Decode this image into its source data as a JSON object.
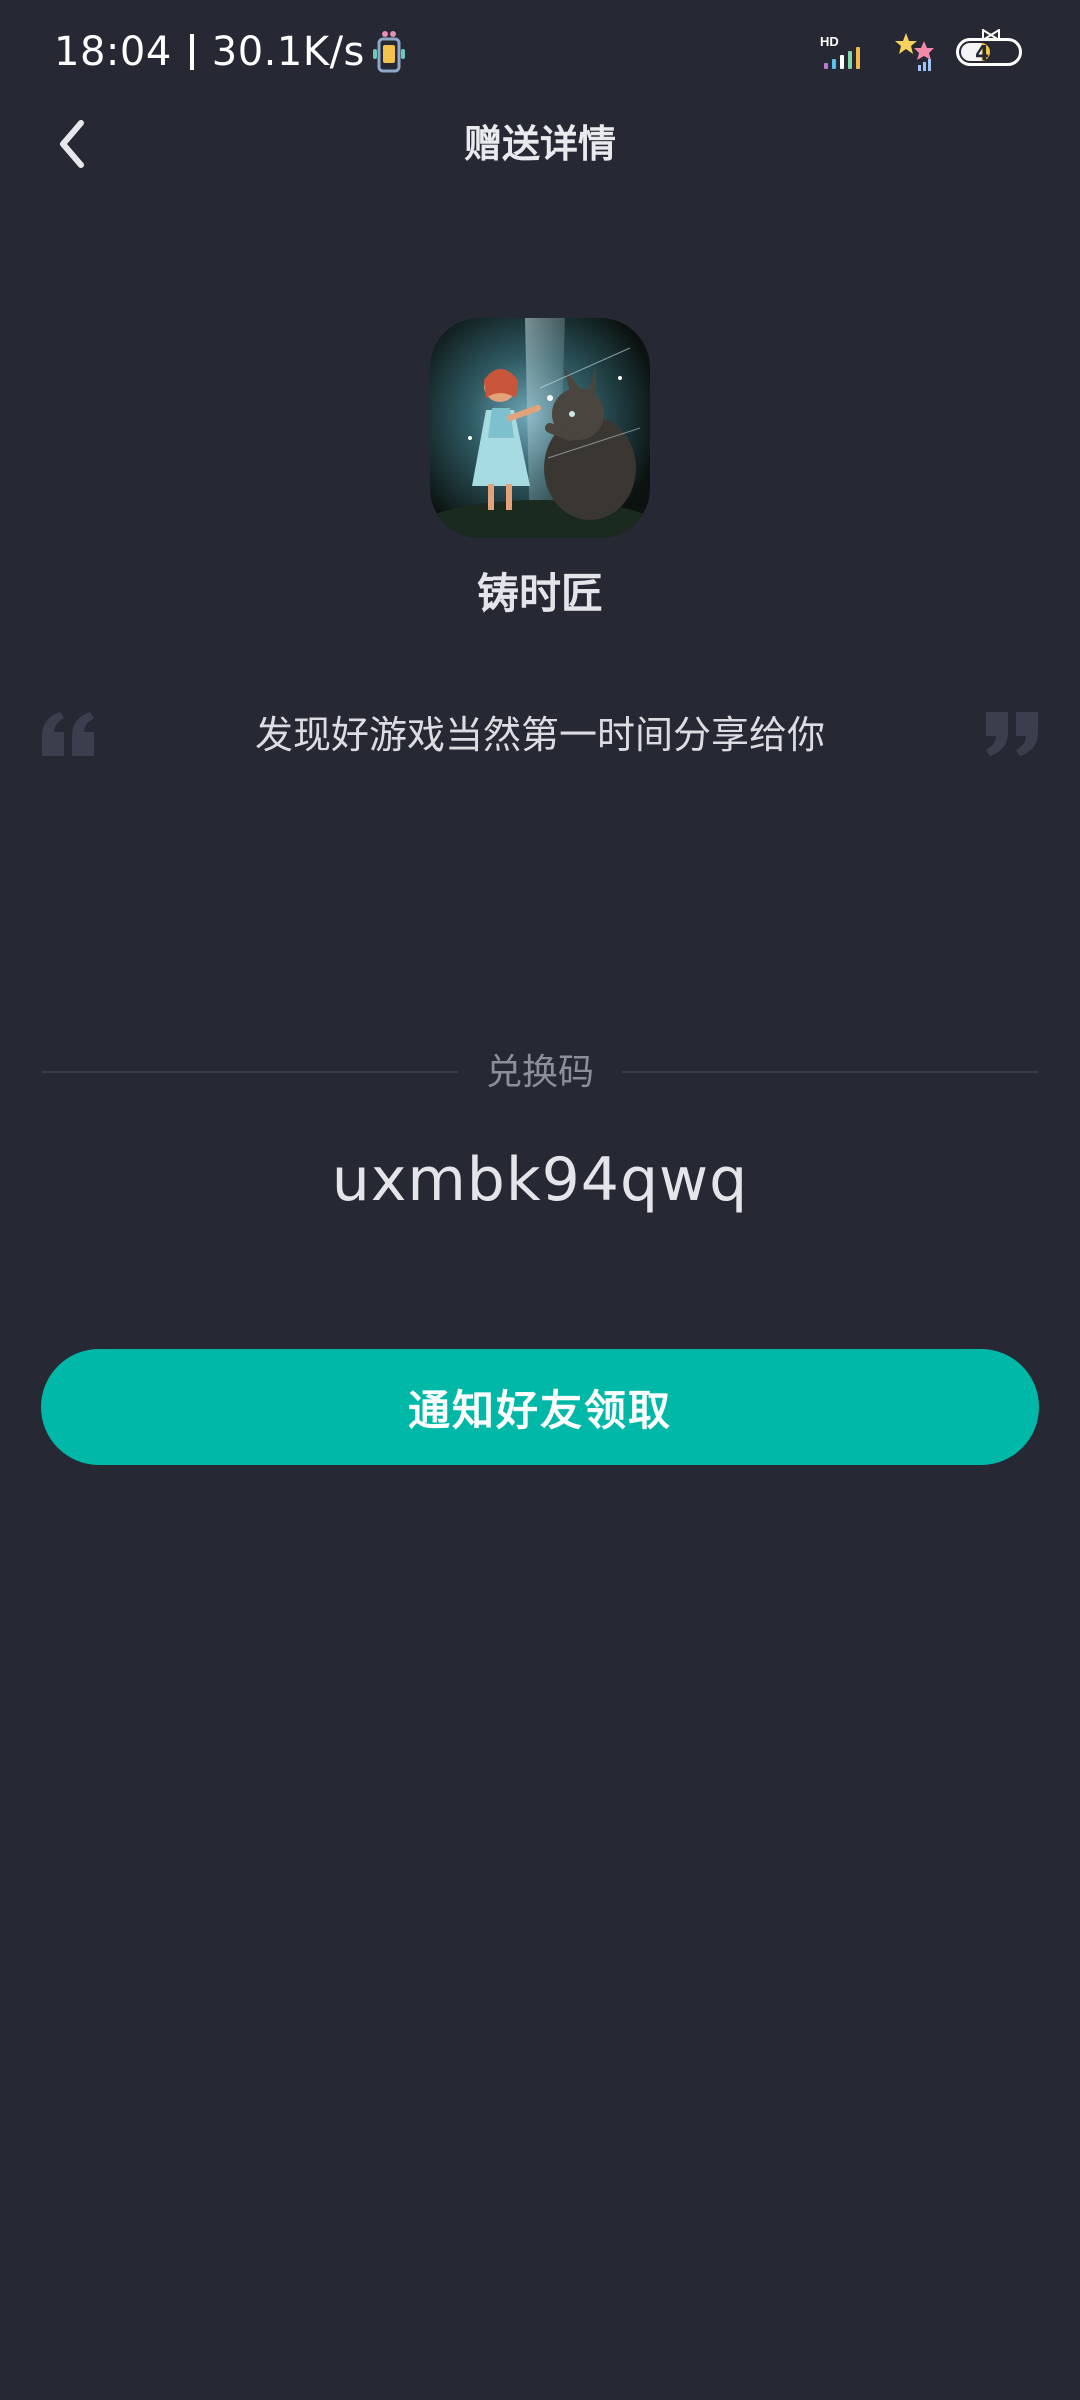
{
  "status_bar": {
    "time": "18:04",
    "network_speed": "30.1K/s",
    "signal_label": "HD",
    "battery_level": "49"
  },
  "nav": {
    "back_icon": "chevron-left-icon",
    "title": "赠送详情"
  },
  "game": {
    "icon": "game-app-icon",
    "name": "铸时匠"
  },
  "message": {
    "text": "发现好游戏当然第一时间分享给你"
  },
  "redeem": {
    "label": "兑换码",
    "code": "uxmbk94qwq"
  },
  "action": {
    "notify_label": "通知好友领取"
  },
  "colors": {
    "background": "#262833",
    "accent": "#00b8a8",
    "divider": "#363948",
    "muted_text": "#8c8e9a",
    "quote_mark": "#3b3e4c"
  }
}
